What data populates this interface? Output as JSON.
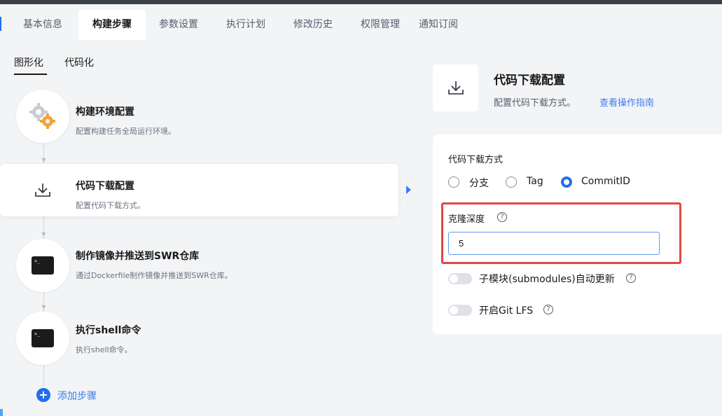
{
  "tabs": [
    "基本信息",
    "构建步骤",
    "参数设置",
    "执行计划",
    "修改历史",
    "权限管理",
    "通知订阅"
  ],
  "active_tab": "构建步骤",
  "left": {
    "mode_tabs": [
      "图形化",
      "代码化"
    ],
    "active_mode": "图形化",
    "steps": [
      {
        "title": "构建环境配置",
        "desc": "配置构建任务全局运行环境。",
        "icon": "gear-cluster-icon"
      },
      {
        "title": "代码下载配置",
        "desc": "配置代码下载方式。",
        "icon": "download-icon"
      },
      {
        "title": "制作镜像并推送到SWR仓库",
        "desc": "通过Dockerfile制作镜像并推送到SWR仓库。",
        "icon": "terminal-icon"
      },
      {
        "title": "执行shell命令",
        "desc": "执行shell命令。",
        "icon": "terminal-icon"
      }
    ],
    "selected_step": 1,
    "add_step": "添加步骤"
  },
  "right": {
    "title": "代码下载配置",
    "desc": "配置代码下载方式。",
    "link": "查看操作指南",
    "download_method_label": "代码下载方式",
    "download_options": [
      "分支",
      "Tag",
      "CommitID"
    ],
    "selected_option": "CommitID",
    "clone_depth_label": "克隆深度",
    "clone_depth_value": "5",
    "submodules_label": "子模块(submodules)自动更新",
    "submodules_enabled": false,
    "git_lfs_label": "开启Git LFS",
    "git_lfs_enabled": false
  },
  "colors": {
    "accent": "#1f6ff0",
    "highlight_border": "#e24646",
    "panel_bg": "#f3f4f6"
  }
}
